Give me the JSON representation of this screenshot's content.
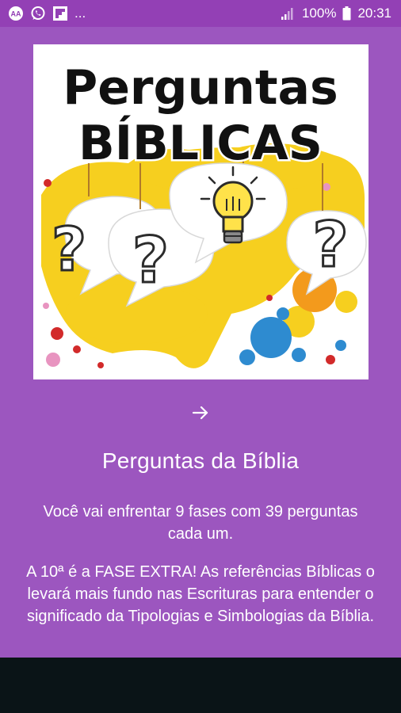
{
  "status_bar": {
    "left_icons": [
      "app-notification-icon",
      "whatsapp-icon",
      "flipboard-icon"
    ],
    "ellipsis": "...",
    "battery_percent": "100%",
    "time": "20:31"
  },
  "hero_image": {
    "line1": "Perguntas",
    "line2": "BÍBLICAS",
    "marks": [
      "?",
      "?",
      "?"
    ]
  },
  "onboarding": {
    "next_icon": "arrow-right-icon",
    "title": "Perguntas da Bíblia",
    "paragraph1": "Você vai enfrentar 9 fases com 39 perguntas cada um.",
    "paragraph2": "A 10ª é a FASE EXTRA! As referências Bíblicas o levará mais fundo nas Escrituras para entender o significado da Tipologias e Simbologias da Bíblia."
  },
  "colors": {
    "status_bar": "#9340b5",
    "screen_bg": "#9c56bf",
    "nav_bar": "#0a1417",
    "splash_yellow": "#f6cf1f"
  }
}
